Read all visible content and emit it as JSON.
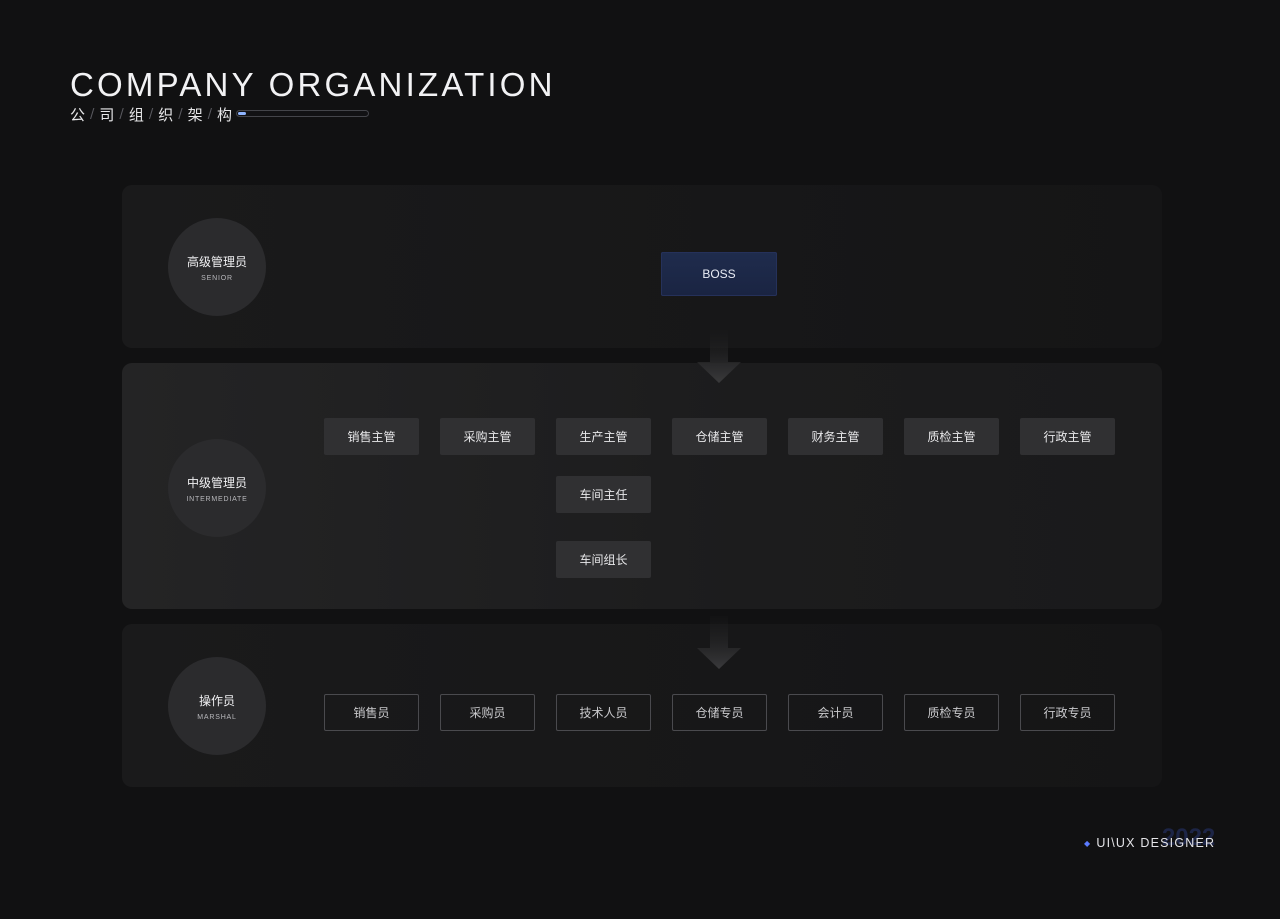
{
  "header": {
    "title": "COMPANY ORGANIZATION",
    "subtitle_chars": [
      "公",
      "司",
      "组",
      "织",
      "架",
      "构"
    ],
    "separator": "/",
    "progress": 0.06
  },
  "levels": {
    "senior": {
      "zh": "高级管理员",
      "en": "SENIOR"
    },
    "intermediate": {
      "zh": "中级管理员",
      "en": "INTERMEDIATE"
    },
    "marshal": {
      "zh": "操作员",
      "en": "MARSHAL"
    }
  },
  "boss": "BOSS",
  "middle_managers": [
    "销售主管",
    "采购主管",
    "生产主管",
    "仓储主管",
    "财务主管",
    "质检主管",
    "行政主管"
  ],
  "production_chain": [
    "车间主任",
    "车间组长"
  ],
  "operators": [
    "销售员",
    "采购员",
    "技术人员",
    "仓储专员",
    "会计员",
    "质检专员",
    "行政专员"
  ],
  "branding": {
    "label": "UI\\UX DESIGNER",
    "year": "2022"
  },
  "colors": {
    "background": "#111112",
    "boss_fill": "#1f2c4d",
    "accent": "#5b7bff",
    "progress_fill": "#8fb5ff"
  }
}
